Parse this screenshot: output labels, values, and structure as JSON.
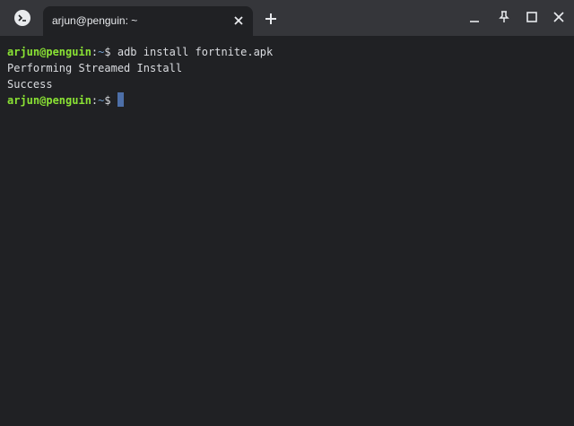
{
  "tabs": [
    {
      "title": "arjun@penguin: ~"
    }
  ],
  "icons": {
    "app": "terminal-icon",
    "tab_close": "close-icon",
    "new_tab": "plus-icon",
    "minimize": "minimize-icon",
    "pin": "pin-icon",
    "maximize": "maximize-icon",
    "close": "close-icon"
  },
  "terminal": {
    "lines": [
      {
        "user": "arjun@penguin",
        "sep": ":",
        "path": "~",
        "sym": "$",
        "command": " adb install fortnite.apk"
      },
      {
        "output": "Performing Streamed Install"
      },
      {
        "output": "Success"
      },
      {
        "user": "arjun@penguin",
        "sep": ":",
        "path": "~",
        "sym": "$",
        "command": " "
      }
    ]
  },
  "colors": {
    "background": "#202124",
    "titlebar": "#35363a",
    "prompt_user": "#8ae234",
    "prompt_path": "#729fcf",
    "text": "#dadce0",
    "cursor": "#4d6fa8"
  }
}
